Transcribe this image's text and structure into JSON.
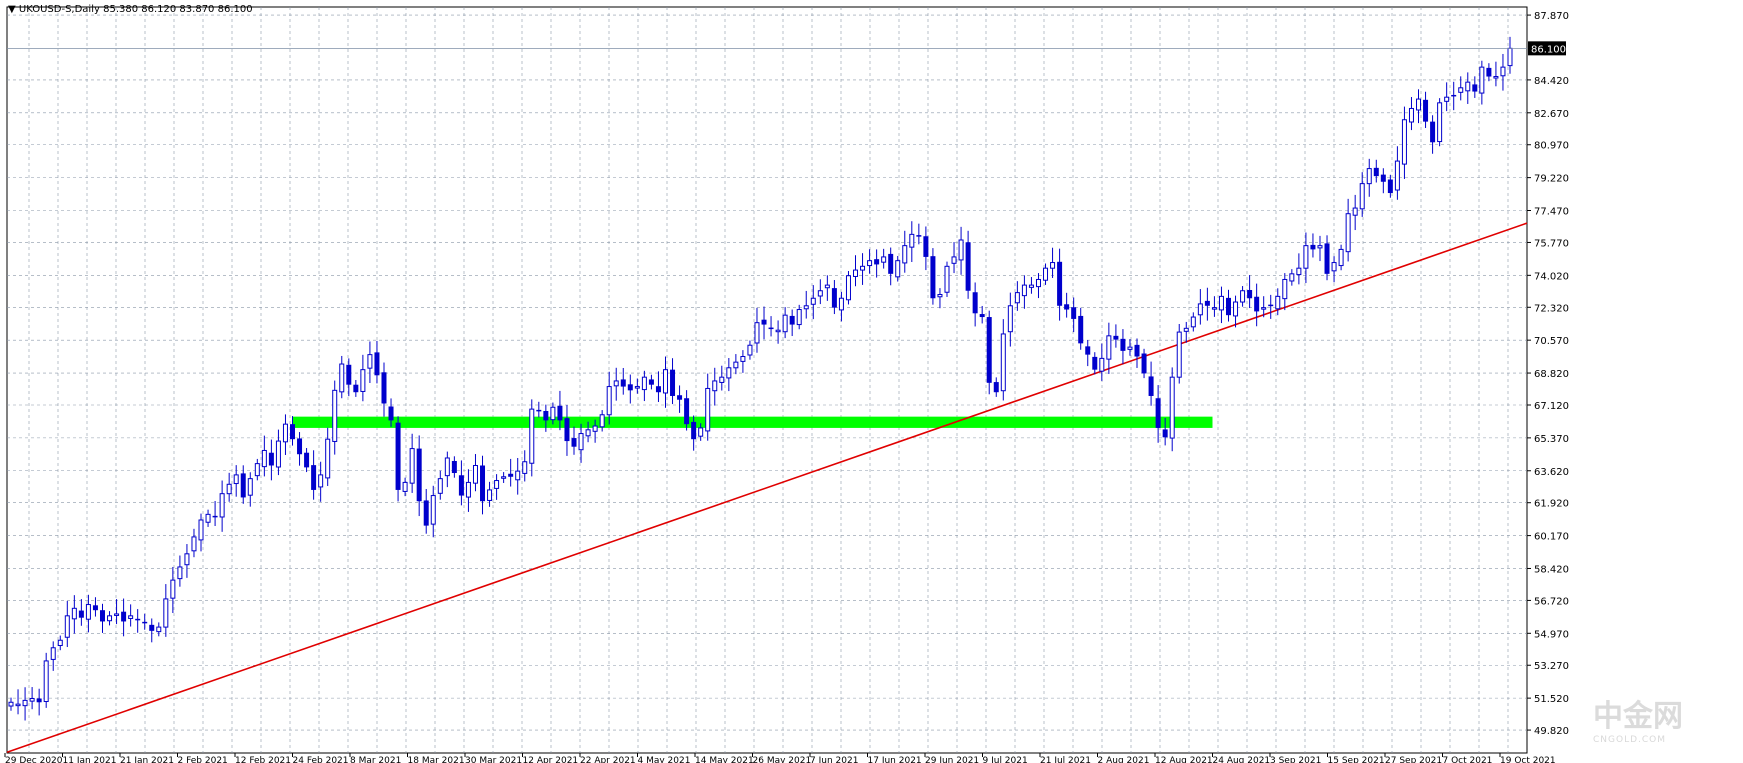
{
  "header": {
    "arrow": "▼",
    "symbol": "UKOUSD-S,Daily",
    "ohlc": "85.380 86.120 83.870 86.100"
  },
  "watermark": {
    "text": "中金网",
    "sub": "CNGOLD.COM"
  },
  "colors": {
    "candle": "#0000cc",
    "grid": "#8a97a8",
    "trendline": "#e00000",
    "support": "#00ff00",
    "background": "#ffffff"
  },
  "chart_data": {
    "type": "candlestick",
    "symbol": "UKOUSD-S",
    "timeframe": "Daily",
    "ylim": [
      48.6,
      88.3
    ],
    "yticks": [
      "87.870",
      "84.420",
      "82.670",
      "80.970",
      "79.220",
      "77.470",
      "75.770",
      "74.020",
      "72.320",
      "70.570",
      "68.820",
      "67.120",
      "65.370",
      "63.620",
      "61.920",
      "60.170",
      "58.420",
      "56.720",
      "54.970",
      "53.270",
      "51.520",
      "49.820"
    ],
    "current_price": "86.100",
    "xticks": [
      "29 Dec 2020",
      "11 Jan 2021",
      "21 Jan 2021",
      "2 Feb 2021",
      "12 Feb 2021",
      "24 Feb 2021",
      "8 Mar 2021",
      "18 Mar 2021",
      "30 Mar 2021",
      "12 Apr 2021",
      "22 Apr 2021",
      "4 May 2021",
      "14 May 2021",
      "26 May 2021",
      "7 Jun 2021",
      "17 Jun 2021",
      "29 Jun 2021",
      "9 Jul 2021",
      "21 Jul 2021",
      "2 Aug 2021",
      "12 Aug 2021",
      "24 Aug 2021",
      "3 Sep 2021",
      "15 Sep 2021",
      "27 Sep 2021",
      "7 Oct 2021",
      "19 Oct 2021"
    ],
    "closes": [
      51.3,
      51.2,
      51.4,
      51.5,
      51.3,
      53.5,
      54.2,
      54.6,
      55.9,
      56.3,
      55.8,
      56.5,
      56.2,
      55.6,
      55.9,
      56.0,
      55.6,
      55.9,
      55.7,
      55.5,
      55.1,
      55.3,
      56.8,
      57.8,
      58.5,
      59.2,
      60.1,
      61.0,
      61.3,
      61.2,
      62.4,
      62.9,
      63.4,
      62.2,
      63.2,
      64.0,
      64.7,
      63.9,
      65.2,
      66.1,
      65.3,
      64.5,
      63.8,
      62.6,
      63.4,
      65.3,
      67.9,
      69.3,
      68.2,
      67.8,
      69.0,
      69.8,
      68.7,
      67.2,
      66.3,
      62.6,
      63.0,
      64.8,
      62.0,
      60.7,
      62.3,
      63.2,
      64.3,
      63.5,
      62.3,
      63.0,
      63.9,
      62.0,
      62.6,
      63.1,
      63.3,
      63.3,
      63.6,
      64.1,
      66.9,
      66.8,
      66.3,
      67.0,
      66.3,
      65.2,
      64.9,
      65.6,
      65.8,
      66.0,
      66.6,
      68.1,
      68.4,
      68.1,
      67.9,
      68.1,
      68.6,
      68.2,
      67.8,
      69.0,
      67.6,
      67.4,
      66.1,
      65.3,
      65.9,
      68.0,
      68.4,
      68.6,
      69.1,
      69.4,
      69.7,
      70.3,
      71.5,
      71.4,
      71.2,
      71.1,
      71.9,
      71.4,
      72.2,
      72.4,
      72.8,
      73.2,
      73.5,
      72.3,
      72.8,
      74.0,
      74.3,
      74.5,
      74.8,
      74.6,
      75.0,
      74.1,
      74.8,
      75.6,
      76.2,
      76.1,
      75.0,
      72.8,
      73.0,
      74.5,
      75.0,
      75.9,
      73.2,
      72.0,
      71.8,
      68.3,
      67.8,
      70.9,
      72.4,
      73.1,
      73.5,
      73.5,
      73.8,
      74.4,
      74.7,
      72.4,
      72.2,
      71.7,
      70.4,
      69.8,
      69.0,
      69.6,
      70.8,
      70.6,
      70.0,
      70.2,
      69.7,
      68.8,
      67.6,
      65.9,
      65.4,
      68.6,
      71.0,
      71.2,
      71.8,
      72.5,
      72.4,
      72.3,
      72.9,
      71.9,
      72.6,
      73.2,
      72.8,
      72.1,
      72.3,
      72.4,
      72.9,
      73.8,
      74.1,
      74.4,
      75.6,
      75.4,
      75.6,
      74.1,
      74.7,
      75.4,
      77.3,
      77.6,
      78.9,
      79.7,
      79.3,
      79.0,
      78.4,
      80.1,
      82.3,
      82.9,
      83.4,
      82.2,
      81.1,
      83.2,
      83.5,
      83.6,
      84.0,
      84.3,
      83.8,
      85.1,
      84.6,
      84.6,
      85.1,
      86.1
    ],
    "trendline": {
      "from": {
        "date": "29 Dec 2020",
        "price": 48.6
      },
      "to": {
        "date": "19 Oct 2021",
        "price": 76.3
      }
    },
    "support_zone": {
      "from": "24 Feb 2021",
      "to": "24 Aug 2021",
      "low": 65.9,
      "high": 66.5
    }
  }
}
